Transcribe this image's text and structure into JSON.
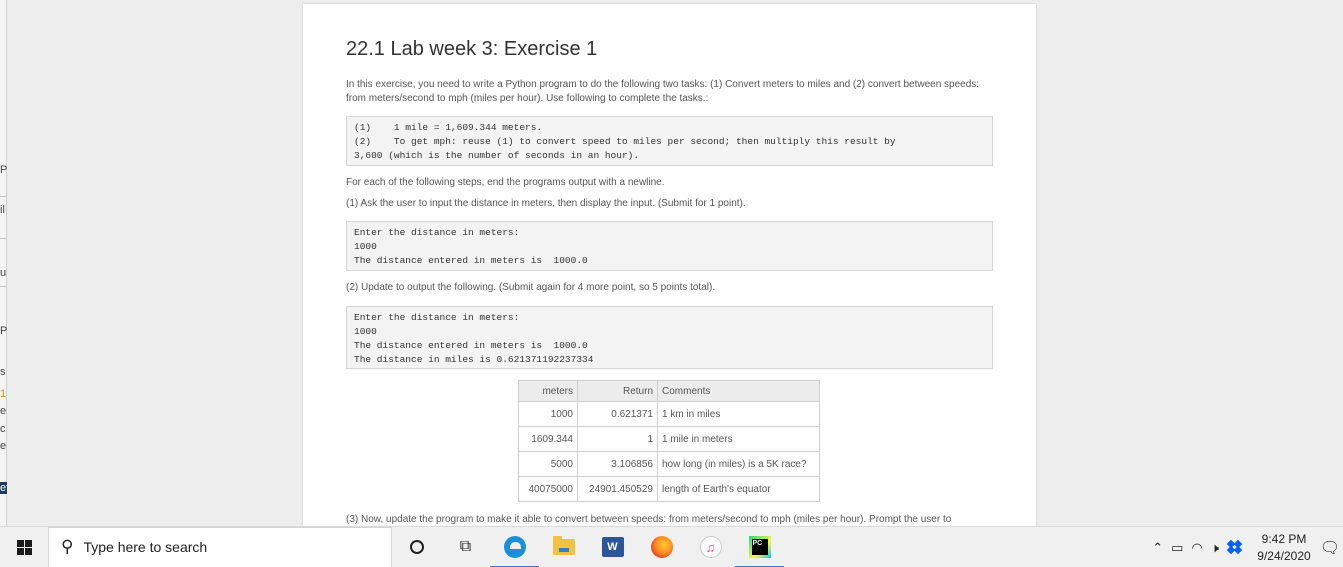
{
  "page": {
    "title": "22.1 Lab week 3: Exercise 1",
    "intro": "In this exercise, you need to write a Python program to do the following two tasks: (1) Convert meters to miles and (2) convert between speeds: from meters/second to mph (miles per hour). Use following to complete the tasks.:",
    "formula_box": "(1)    1 mile = 1,609.344 meters.\n(2)    To get mph: reuse (1) to convert speed to miles per second; then multiply this result by\n3,600 (which is the number of seconds in an hour).",
    "steps_note": "For each of the following steps, end the programs output with a newline.",
    "step1": "(1) Ask the user to input the distance in meters, then display the input. (Submit for 1 point).",
    "step1_output": "Enter the distance in meters:\n1000\nThe distance entered in meters is  1000.0",
    "step2": "(2) Update to output the following. (Submit again for 4 more point, so 5 points total).",
    "step2_output": "Enter the distance in meters:\n1000\nThe distance entered in meters is  1000.0\nThe distance in miles is 0.621371192237334",
    "step3_partial": "(3) Now, update the program to make it able to convert between speeds: from meters/second to mph (miles per hour). Prompt the user to"
  },
  "table": {
    "headers": [
      "meters",
      "Return",
      "Comments"
    ],
    "rows": [
      [
        "1000",
        "0.621371",
        "1 km in miles"
      ],
      [
        "1609.344",
        "1",
        "1 mile in meters"
      ],
      [
        "5000",
        "3.106856",
        "how long (in miles) is a 5K race?"
      ],
      [
        "40075000",
        "24901.450529",
        "length of Earth's equator"
      ]
    ]
  },
  "taskbar": {
    "search_placeholder": "Type here to search",
    "word_letter": "W",
    "pycharm_letters": "PC",
    "time": "9:42 PM",
    "date": "9/24/2020"
  },
  "left_fragments": [
    "P",
    "il",
    "u",
    "P",
    "s",
    "1",
    "e",
    "c",
    "e",
    "et"
  ],
  "colors": {
    "taskbar_bg": "#f0f0f0",
    "accent": "#3b78d8",
    "card_bg": "#ffffff",
    "code_bg": "#f3f3f3"
  },
  "icons": [
    "windows-icon",
    "search-icon",
    "cortana-icon",
    "task-view-icon",
    "edge-icon",
    "file-explorer-icon",
    "word-icon",
    "firefox-icon",
    "itunes-icon",
    "pycharm-icon",
    "chevron-up-icon",
    "battery-icon",
    "wifi-icon",
    "volume-mute-icon",
    "dropbox-icon",
    "notification-icon"
  ]
}
